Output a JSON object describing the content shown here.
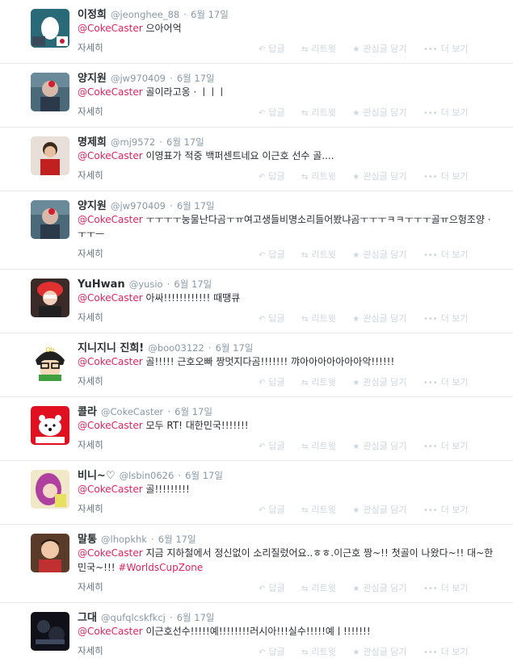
{
  "actions": {
    "reply": "답글",
    "retweet": "리트윗",
    "favorite": "관심글 담기",
    "more": "더 보기",
    "detail": "자세히"
  },
  "tweets": [
    {
      "name": "이정희",
      "handle": "@jeonghee_88",
      "time": "6월 17일",
      "mention": "@CokeCaster",
      "text": " 으아어억",
      "hashtag": "",
      "avatar": "egg-icon"
    },
    {
      "name": "양지원",
      "handle": "@jw970409",
      "time": "6월 17일",
      "mention": "@CokeCaster",
      "text": " 골이라고옹ㆍㅣㅣㅣ",
      "hashtag": "",
      "avatar": "photo"
    },
    {
      "name": "명제희",
      "handle": "@mj9572",
      "time": "6월 17일",
      "mention": "@CokeCaster",
      "text": " 이영표가 적중 백퍼센트네요 이근호 선수 골....",
      "hashtag": "",
      "avatar": "photo"
    },
    {
      "name": "양지원",
      "handle": "@jw970409",
      "time": "6월 17일",
      "mention": "@CokeCaster",
      "text": " ㅜㅜㅜㅜ눙물난다곰ㅜㅠ여고생들비명소리들어봤냐곰ㅜㅜㅜㅋㅋㅜㅜㅜ골ㅠ으헝조양ㆍㅜㅜㅡ",
      "hashtag": "",
      "avatar": "photo"
    },
    {
      "name": "YuHwan",
      "handle": "@yusio",
      "time": "6월 17일",
      "mention": "@CokeCaster",
      "text": " 아싸!!!!!!!!!!!! 때땡큐",
      "hashtag": "",
      "avatar": "photo"
    },
    {
      "name": "지니지니 진희!",
      "handle": "@boo03122",
      "time": "6월 17일",
      "mention": "@CokeCaster",
      "text": " 골!!!!! 근호오빠 짱멋지다곰!!!!!!! 꺄아아아아아아아악!!!!!!",
      "hashtag": "",
      "avatar": "cartoon"
    },
    {
      "name": "콜라",
      "handle": "@CokeCaster",
      "time": "6월 17일",
      "mention": "@CokeCaster",
      "text": " 모두 RT! 대한민국!!!!!!!",
      "hashtag": "",
      "avatar": "coke-bear"
    },
    {
      "name": "비니~♡",
      "handle": "@lsbin0626",
      "time": "6월 17일",
      "mention": "@CokeCaster",
      "text": " 골!!!!!!!!!",
      "hashtag": "",
      "avatar": "photo"
    },
    {
      "name": "말통",
      "handle": "@lhopkhk",
      "time": "6월 17일",
      "mention": "@CokeCaster",
      "text": " 지금 지하철에서 정신없이 소리질렀어요..ㅎㅎ.이근호 짱~!!  첫골이 나왔다~!! 대~한민국~!!! ",
      "hashtag": "#WorldsCupZone",
      "avatar": "photo"
    },
    {
      "name": "그대",
      "handle": "@qufqlcskfkcj",
      "time": "6월 17일",
      "mention": "@CokeCaster",
      "text": " 이근호선수!!!!!예!!!!!!!!러시아!!!실수!!!!!예ㅣ!!!!!!!",
      "hashtag": "",
      "avatar": "photo"
    }
  ],
  "colors": {
    "mention": "#e0245e",
    "meta": "#8899a6",
    "actions": "#ccd6dd"
  }
}
